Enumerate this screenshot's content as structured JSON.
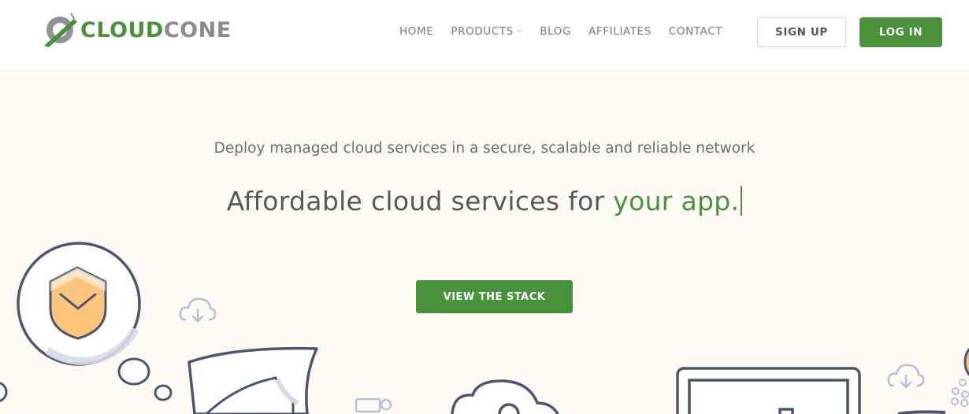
{
  "brand": {
    "name_part1": "CLOUD",
    "name_part2": "CONE",
    "primary_color": "#4a913c",
    "secondary_color": "#888b90"
  },
  "nav": {
    "items": [
      {
        "label": "HOME"
      },
      {
        "label": "PRODUCTS",
        "has_dropdown": true
      },
      {
        "label": "BLOG"
      },
      {
        "label": "AFFILIATES"
      },
      {
        "label": "CONTACT"
      }
    ],
    "signup_label": "SIGN UP",
    "login_label": "LOG IN"
  },
  "hero": {
    "subtitle": "Deploy managed cloud services in a secure, scalable and reliable network",
    "headline_prefix": "Affordable cloud services for ",
    "headline_accent": "your app.",
    "cta_label": "VIEW THE STACK"
  },
  "illustration": {
    "icons": [
      "shield-bubble-icon",
      "cloud-download-icon",
      "document-icon",
      "cloud-lock-icon",
      "laptop-icon",
      "cloud-download-icon"
    ],
    "shield_color": "#fbc57c",
    "line_color": "#4c5670"
  }
}
